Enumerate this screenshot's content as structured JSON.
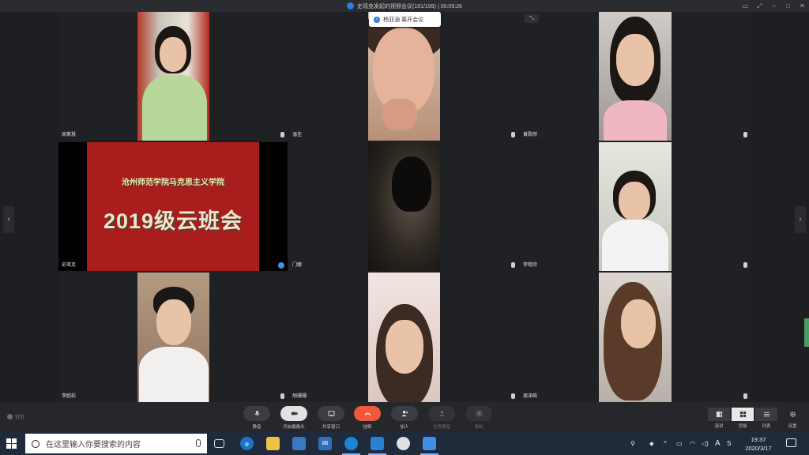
{
  "title_bar": {
    "title": "史瑶克发起的视频会议(181/199) | 00:09:26"
  },
  "notice": {
    "text": "杨亚涵 离开会议"
  },
  "participants": [
    {
      "name": "宋紫慧"
    },
    {
      "name": "温佳"
    },
    {
      "name": "黄歌然"
    },
    {
      "name": "史瑶克"
    },
    {
      "name": "门娜"
    },
    {
      "name": "李菀欣"
    },
    {
      "name": "李欧前"
    },
    {
      "name": "胡珊珊"
    },
    {
      "name": "周泽皓"
    }
  ],
  "slide": {
    "line1": "沧州师范学院马克思主义学院",
    "line2": "2019级云班会"
  },
  "toolbar": {
    "pin": "钉钉",
    "buttons": [
      {
        "label": "静音",
        "icon": "microphone-icon"
      },
      {
        "label": "开启摄像头",
        "icon": "camera-icon"
      },
      {
        "label": "共享窗口",
        "icon": "screen-share-icon"
      },
      {
        "label": "挂断",
        "icon": "hangup-icon"
      },
      {
        "label": "加人",
        "icon": "add-person-icon"
      },
      {
        "label": "全员静音",
        "icon": "mute-all-icon"
      },
      {
        "label": "录制",
        "icon": "record-icon"
      }
    ],
    "layouts": [
      {
        "label": "演讲",
        "icon": "speaker-layout-icon"
      },
      {
        "label": "宫格",
        "icon": "grid-layout-icon"
      },
      {
        "label": "列表",
        "icon": "list-layout-icon"
      }
    ],
    "settings_label": "设置"
  },
  "taskbar": {
    "search_placeholder": "在这里输入你要搜索的内容",
    "ime": "A",
    "time": "19:37",
    "date": "2020/3/17"
  },
  "colors": {
    "hangup": "#f05a3a",
    "accent": "#2f7de1",
    "slide_bg": "#a91d1d"
  }
}
